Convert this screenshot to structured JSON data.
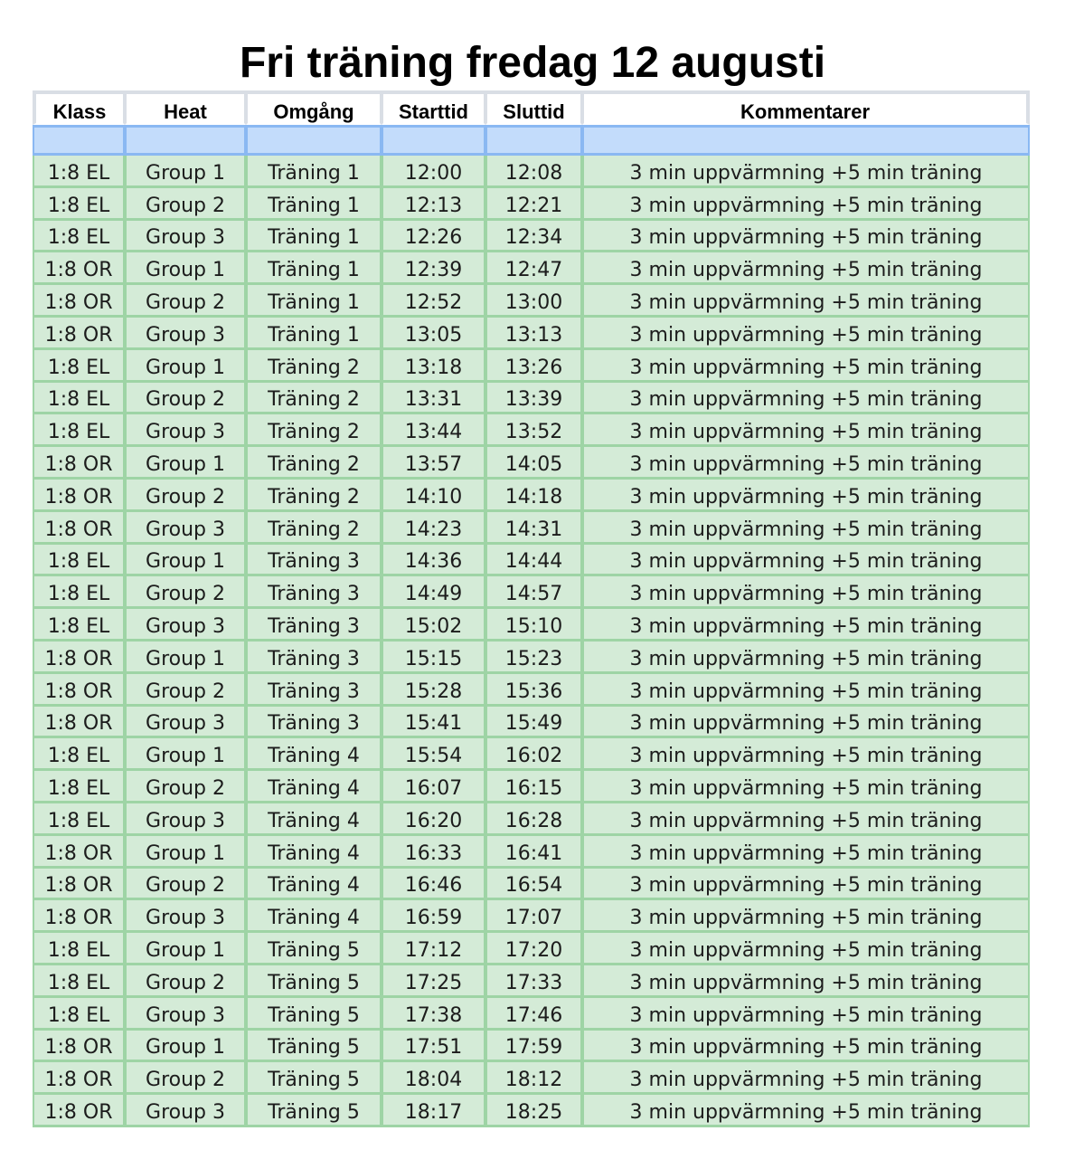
{
  "title": "Fri träning fredag 12 augusti",
  "headers": {
    "klass": "Klass",
    "heat": "Heat",
    "omgang": "Omgång",
    "starttid": "Starttid",
    "sluttid": "Sluttid",
    "kommentarer": "Kommentarer"
  },
  "rows": [
    {
      "klass": "1:8 EL",
      "heat": "Group 1",
      "omgang": "Träning 1",
      "start": "12:00",
      "slut": "12:08",
      "kommentar": "3 min uppvärmning +5 min träning"
    },
    {
      "klass": "1:8 EL",
      "heat": "Group 2",
      "omgang": "Träning 1",
      "start": "12:13",
      "slut": "12:21",
      "kommentar": "3 min uppvärmning +5 min träning"
    },
    {
      "klass": "1:8 EL",
      "heat": "Group 3",
      "omgang": "Träning 1",
      "start": "12:26",
      "slut": "12:34",
      "kommentar": "3 min uppvärmning +5 min träning"
    },
    {
      "klass": "1:8 OR",
      "heat": "Group 1",
      "omgang": "Träning 1",
      "start": "12:39",
      "slut": "12:47",
      "kommentar": "3 min uppvärmning +5 min träning"
    },
    {
      "klass": "1:8 OR",
      "heat": "Group 2",
      "omgang": "Träning 1",
      "start": "12:52",
      "slut": "13:00",
      "kommentar": "3 min uppvärmning +5 min träning"
    },
    {
      "klass": "1:8 OR",
      "heat": "Group 3",
      "omgang": "Träning 1",
      "start": "13:05",
      "slut": "13:13",
      "kommentar": "3 min uppvärmning +5 min träning"
    },
    {
      "klass": "1:8 EL",
      "heat": "Group 1",
      "omgang": "Träning 2",
      "start": "13:18",
      "slut": "13:26",
      "kommentar": "3 min uppvärmning +5 min träning"
    },
    {
      "klass": "1:8 EL",
      "heat": "Group 2",
      "omgang": "Träning 2",
      "start": "13:31",
      "slut": "13:39",
      "kommentar": "3 min uppvärmning +5 min träning"
    },
    {
      "klass": "1:8 EL",
      "heat": "Group 3",
      "omgang": "Träning 2",
      "start": "13:44",
      "slut": "13:52",
      "kommentar": "3 min uppvärmning +5 min träning"
    },
    {
      "klass": "1:8 OR",
      "heat": "Group 1",
      "omgang": "Träning 2",
      "start": "13:57",
      "slut": "14:05",
      "kommentar": "3 min uppvärmning +5 min träning"
    },
    {
      "klass": "1:8 OR",
      "heat": "Group 2",
      "omgang": "Träning 2",
      "start": "14:10",
      "slut": "14:18",
      "kommentar": "3 min uppvärmning +5 min träning"
    },
    {
      "klass": "1:8 OR",
      "heat": "Group 3",
      "omgang": "Träning 2",
      "start": "14:23",
      "slut": "14:31",
      "kommentar": "3 min uppvärmning +5 min träning"
    },
    {
      "klass": "1:8 EL",
      "heat": "Group 1",
      "omgang": "Träning 3",
      "start": "14:36",
      "slut": "14:44",
      "kommentar": "3 min uppvärmning +5 min träning"
    },
    {
      "klass": "1:8 EL",
      "heat": "Group 2",
      "omgang": "Träning 3",
      "start": "14:49",
      "slut": "14:57",
      "kommentar": "3 min uppvärmning +5 min träning"
    },
    {
      "klass": "1:8 EL",
      "heat": "Group 3",
      "omgang": "Träning 3",
      "start": "15:02",
      "slut": "15:10",
      "kommentar": "3 min uppvärmning +5 min träning"
    },
    {
      "klass": "1:8 OR",
      "heat": "Group 1",
      "omgang": "Träning 3",
      "start": "15:15",
      "slut": "15:23",
      "kommentar": "3 min uppvärmning +5 min träning"
    },
    {
      "klass": "1:8 OR",
      "heat": "Group 2",
      "omgang": "Träning 3",
      "start": "15:28",
      "slut": "15:36",
      "kommentar": "3 min uppvärmning +5 min träning"
    },
    {
      "klass": "1:8 OR",
      "heat": "Group 3",
      "omgang": "Träning 3",
      "start": "15:41",
      "slut": "15:49",
      "kommentar": "3 min uppvärmning +5 min träning"
    },
    {
      "klass": "1:8 EL",
      "heat": "Group 1",
      "omgang": "Träning 4",
      "start": "15:54",
      "slut": "16:02",
      "kommentar": "3 min uppvärmning +5 min träning"
    },
    {
      "klass": "1:8 EL",
      "heat": "Group 2",
      "omgang": "Träning 4",
      "start": "16:07",
      "slut": "16:15",
      "kommentar": "3 min uppvärmning +5 min träning"
    },
    {
      "klass": "1:8 EL",
      "heat": "Group 3",
      "omgang": "Träning 4",
      "start": "16:20",
      "slut": "16:28",
      "kommentar": "3 min uppvärmning +5 min träning"
    },
    {
      "klass": "1:8 OR",
      "heat": "Group 1",
      "omgang": "Träning 4",
      "start": "16:33",
      "slut": "16:41",
      "kommentar": "3 min uppvärmning +5 min träning"
    },
    {
      "klass": "1:8 OR",
      "heat": "Group 2",
      "omgang": "Träning 4",
      "start": "16:46",
      "slut": "16:54",
      "kommentar": "3 min uppvärmning +5 min träning"
    },
    {
      "klass": "1:8 OR",
      "heat": "Group 3",
      "omgang": "Träning 4",
      "start": "16:59",
      "slut": "17:07",
      "kommentar": "3 min uppvärmning +5 min träning"
    },
    {
      "klass": "1:8 EL",
      "heat": "Group 1",
      "omgang": "Träning 5",
      "start": "17:12",
      "slut": "17:20",
      "kommentar": "3 min uppvärmning +5 min träning"
    },
    {
      "klass": "1:8 EL",
      "heat": "Group 2",
      "omgang": "Träning 5",
      "start": "17:25",
      "slut": "17:33",
      "kommentar": "3 min uppvärmning +5 min träning"
    },
    {
      "klass": "1:8 EL",
      "heat": "Group 3",
      "omgang": "Träning 5",
      "start": "17:38",
      "slut": "17:46",
      "kommentar": "3 min uppvärmning +5 min träning"
    },
    {
      "klass": "1:8 OR",
      "heat": "Group 1",
      "omgang": "Träning 5",
      "start": "17:51",
      "slut": "17:59",
      "kommentar": "3 min uppvärmning +5 min träning"
    },
    {
      "klass": "1:8 OR",
      "heat": "Group 2",
      "omgang": "Träning 5",
      "start": "18:04",
      "slut": "18:12",
      "kommentar": "3 min uppvärmning +5 min träning"
    },
    {
      "klass": "1:8 OR",
      "heat": "Group 3",
      "omgang": "Träning 5",
      "start": "18:17",
      "slut": "18:25",
      "kommentar": "3 min uppvärmning +5 min träning"
    }
  ]
}
